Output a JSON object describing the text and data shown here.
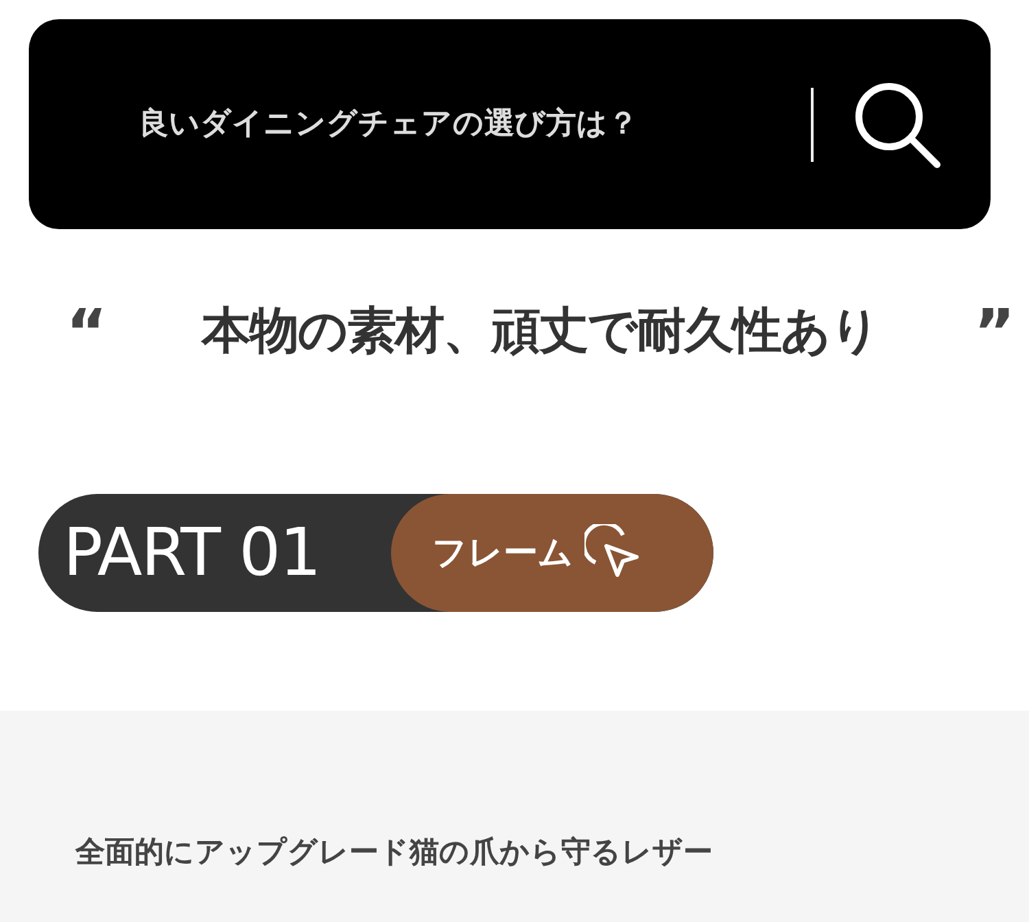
{
  "search": {
    "value": "良いダイニングチェアの選び方は？"
  },
  "headline": {
    "open_quote": "“",
    "text": "本物の素材、頑丈で耐久性あり",
    "close_quote": "”"
  },
  "part": {
    "label": "PART 01",
    "button": "フレーム"
  },
  "section": {
    "text": "全面的にアップグレード猫の爪から守るレザー"
  }
}
